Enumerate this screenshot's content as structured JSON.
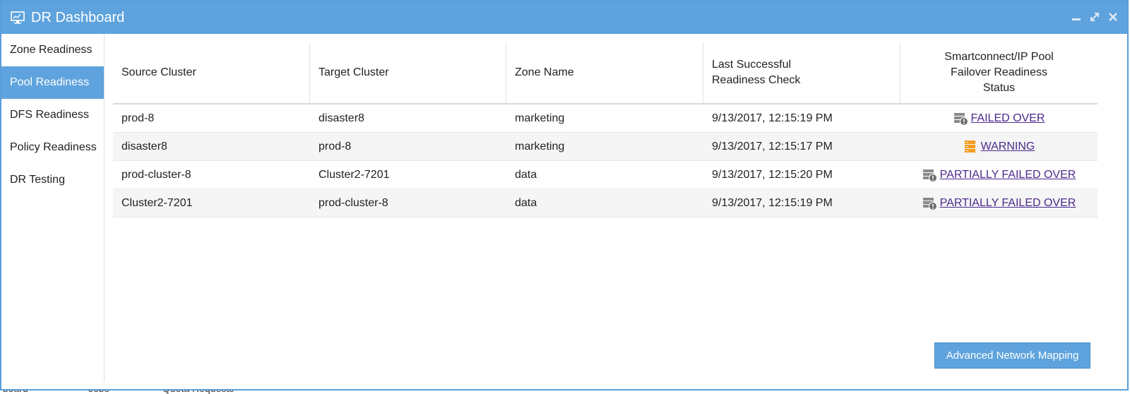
{
  "window": {
    "title": "DR Dashboard",
    "icon": "monitor-icon",
    "controls": [
      "minimize-icon",
      "maximize-icon",
      "close-icon"
    ]
  },
  "sidebar": {
    "items": [
      {
        "label": "Zone Readiness",
        "active": false
      },
      {
        "label": "Pool Readiness",
        "active": true
      },
      {
        "label": "DFS Readiness",
        "active": false
      },
      {
        "label": "Policy Readiness",
        "active": false
      },
      {
        "label": "DR Testing",
        "active": false
      }
    ]
  },
  "table": {
    "headers": [
      "Source Cluster",
      "Target Cluster",
      "Zone Name",
      "Last Successful\nReadiness Check",
      "Smartconnect/IP Pool\nFailover Readiness\nStatus"
    ],
    "rows": [
      {
        "source": "prod-8",
        "target": "disaster8",
        "zone": "marketing",
        "last_check": "9/13/2017, 12:15:19 PM",
        "status": "FAILED OVER",
        "status_icon": "server-failed-icon"
      },
      {
        "source": "disaster8",
        "target": "prod-8",
        "zone": "marketing",
        "last_check": "9/13/2017, 12:15:17 PM",
        "status": "WARNING",
        "status_icon": "server-warning-icon"
      },
      {
        "source": "prod-cluster-8",
        "target": "Cluster2-7201",
        "zone": "data",
        "last_check": "9/13/2017, 12:15:20 PM",
        "status": "PARTIALLY FAILED OVER",
        "status_icon": "server-failed-icon"
      },
      {
        "source": "Cluster2-7201",
        "target": "prod-cluster-8",
        "zone": "data",
        "last_check": "9/13/2017, 12:15:19 PM",
        "status": "PARTIALLY FAILED OVER",
        "status_icon": "server-failed-icon"
      }
    ]
  },
  "actions": {
    "advanced_mapping_label": "Advanced Network Mapping"
  },
  "colors": {
    "accent": "#5ea3dd",
    "link": "#4b2a8c",
    "warning": "#f39c1f",
    "failed_gray": "#8a8a8a"
  },
  "background_tabs": [
    "board",
    "Jobs",
    "Quota Requests"
  ]
}
